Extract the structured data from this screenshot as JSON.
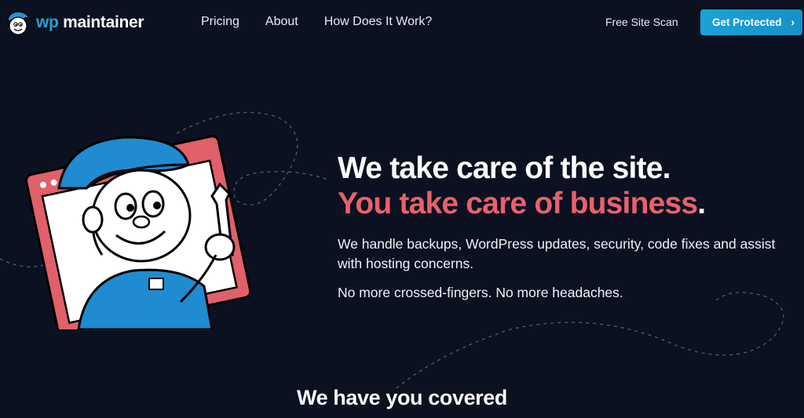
{
  "brand": {
    "wp": "wp",
    "name": "maintainer"
  },
  "nav": {
    "items": [
      {
        "label": "Pricing"
      },
      {
        "label": "About"
      },
      {
        "label": "How Does It Work?"
      }
    ]
  },
  "header": {
    "scan_label": "Free Site Scan",
    "cta_label": "Get Protected",
    "cta_icon": "chevron-right-icon"
  },
  "hero": {
    "headline_1": "We take care of the site.",
    "headline_2": "You take care of business",
    "headline_2_end": ".",
    "description": "We handle backups, WordPress updates, security, code fixes and assist with hosting concerns.",
    "tagline": "No more crossed-fingers. No more headaches."
  },
  "section": {
    "title": "We have you covered"
  },
  "colors": {
    "background": "#0b1120",
    "accent": "#e9606c",
    "brand_blue": "#2a9fd6",
    "cta": "#1aa3d4"
  }
}
